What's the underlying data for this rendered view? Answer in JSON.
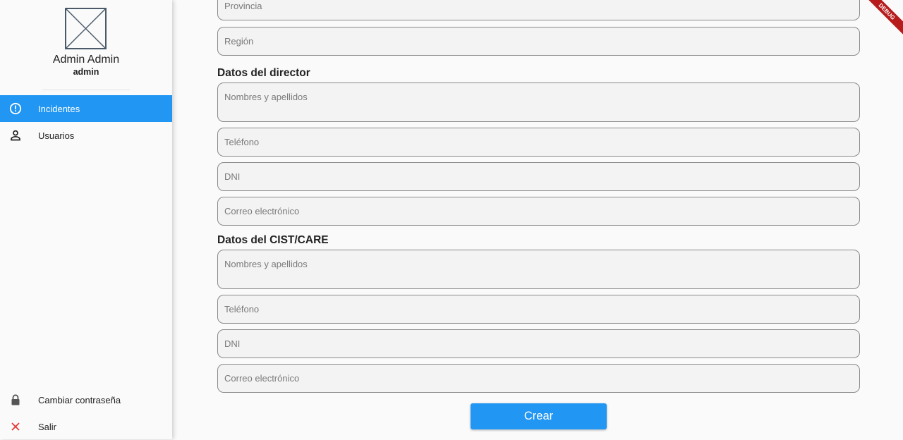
{
  "sidebar": {
    "user_name": "Admin Admin",
    "user_role": "admin",
    "items": [
      {
        "label": "Incidentes",
        "icon": "alert-circle-icon",
        "active": true
      },
      {
        "label": "Usuarios",
        "icon": "person-icon",
        "active": false
      }
    ],
    "bottom_items": [
      {
        "label": "Cambiar contraseña",
        "icon": "lock-icon"
      },
      {
        "label": "Salir",
        "icon": "close-icon"
      }
    ]
  },
  "form": {
    "provincia_placeholder": "Provincia",
    "region_placeholder": "Región",
    "director": {
      "title": "Datos del director",
      "nombres_placeholder": "Nombres y apellidos",
      "telefono_placeholder": "Teléfono",
      "dni_placeholder": "DNI",
      "correo_placeholder": "Correo electrónico"
    },
    "cist": {
      "title": "Datos del CIST/CARE",
      "nombres_placeholder": "Nombres y apellidos",
      "telefono_placeholder": "Teléfono",
      "dni_placeholder": "DNI",
      "correo_placeholder": "Correo electrónico"
    },
    "submit_label": "Crear"
  },
  "debug_banner": "DEBUG",
  "colors": {
    "accent": "#2196f3",
    "debug": "#b71c1c",
    "exit_icon": "#e53935"
  }
}
